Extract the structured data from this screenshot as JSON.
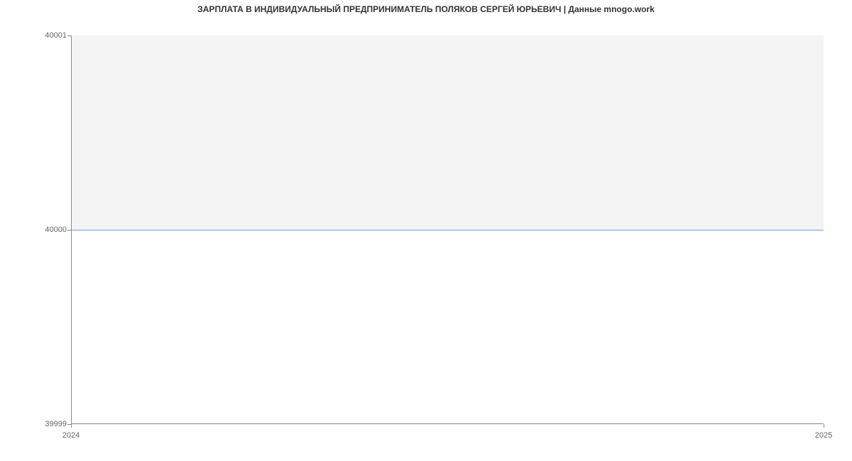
{
  "chart_data": {
    "type": "area",
    "title": "ЗАРПЛАТА В ИНДИВИДУАЛЬНЫЙ ПРЕДПРИНИМАТЕЛЬ ПОЛЯКОВ СЕРГЕЙ ЮРЬЕВИЧ | Данные mnogo.work",
    "x": [
      2024,
      2025
    ],
    "values": [
      40000,
      40000
    ],
    "xlabel": "",
    "ylabel": "",
    "xlim": [
      2024,
      2025
    ],
    "ylim": [
      39999,
      40001
    ],
    "x_ticks": [
      2024,
      2025
    ],
    "y_ticks": [
      39999,
      40000,
      40001
    ],
    "x_tick_labels": [
      "2024",
      "2025"
    ],
    "y_tick_labels": [
      "39999",
      "40000",
      "40001"
    ],
    "line_color": "#6aa0e8",
    "area_color": "#f4f4f4"
  }
}
